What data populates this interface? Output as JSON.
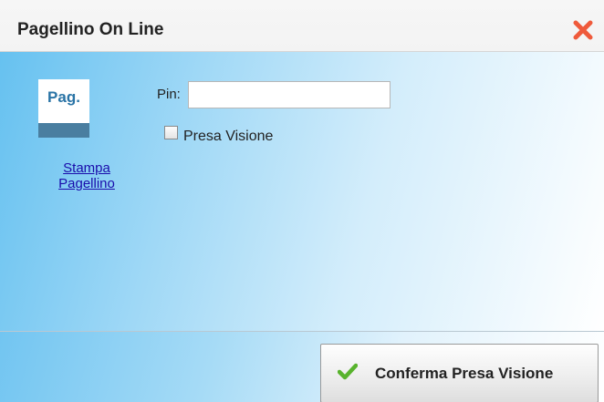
{
  "dialog": {
    "title": "Pagellino On Line",
    "close_icon": "close-x-icon"
  },
  "report": {
    "icon_text": "Pag.",
    "link_line1": "Stampa",
    "link_line2": "Pagellino"
  },
  "form": {
    "pin_label": "Pin:",
    "pin_value": "",
    "checkbox_label": "Presa Visione",
    "checkbox_checked": false
  },
  "footer": {
    "confirm_label": "Conferma Presa Visione",
    "confirm_icon": "checkmark-icon"
  },
  "colors": {
    "close": "#ef5a3b",
    "check": "#58b32d",
    "link": "#1a0dab",
    "icon_text": "#2a74a6",
    "icon_bar": "#4a7ea0"
  }
}
